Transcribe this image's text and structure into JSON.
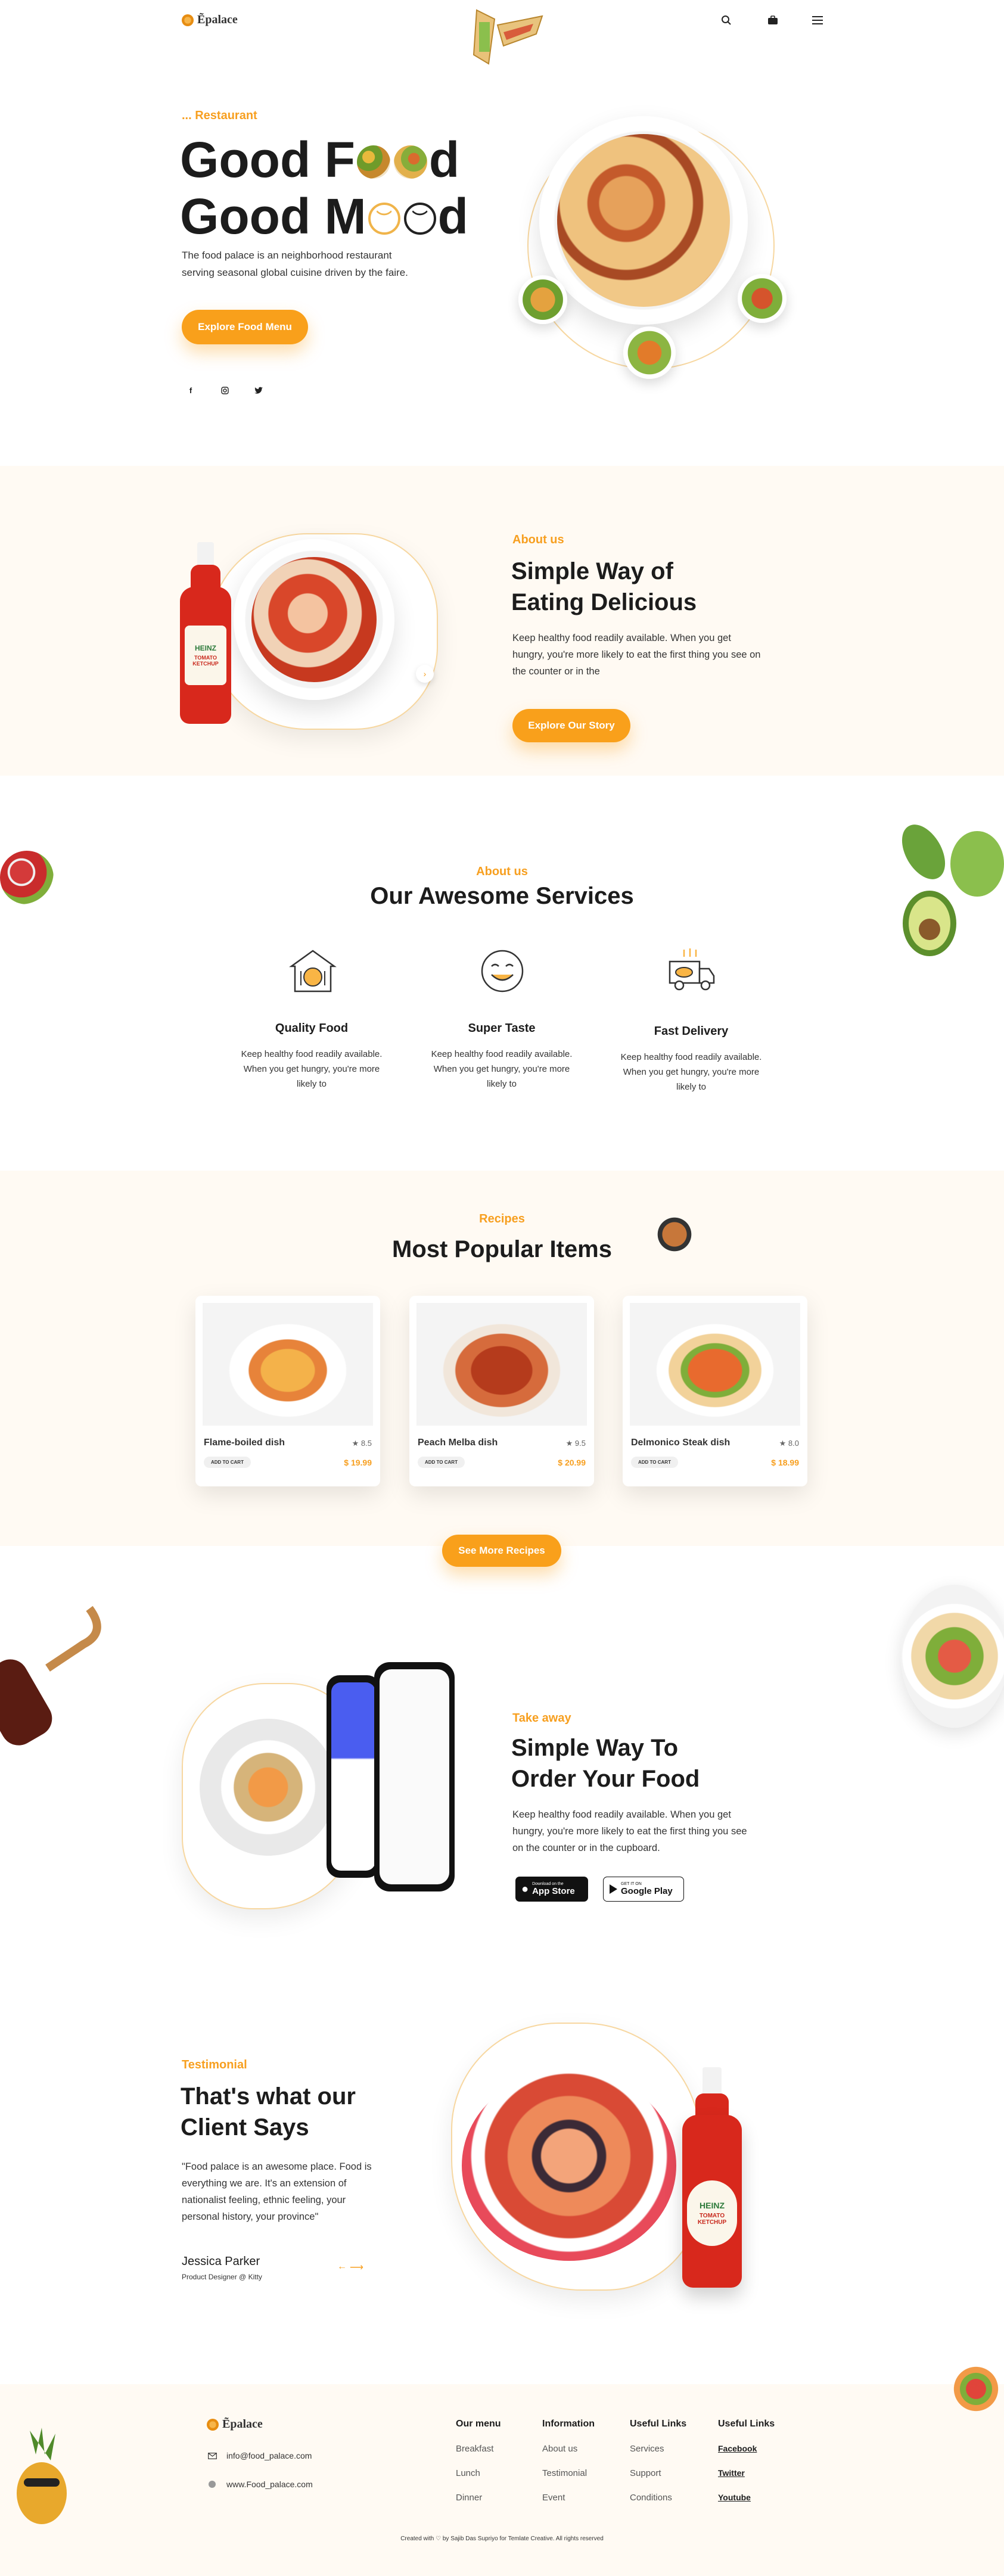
{
  "header": {
    "logo_text": "Ẽpalace",
    "icons": [
      "search-icon",
      "bag-icon",
      "menu-icon"
    ]
  },
  "hero": {
    "tag": "... Restaurant",
    "title_line1_a": "Good F",
    "title_line1_b": "d",
    "title_line2_a": "Good M",
    "title_line2_b": "d",
    "description": "The food palace is an neighborhood restaurant serving seasonal global cuisine driven by the faire.",
    "cta": "Explore Food Menu",
    "social": [
      "facebook-icon",
      "instagram-icon",
      "twitter-icon"
    ]
  },
  "about": {
    "tag": "About us",
    "title_line1": "Simple Way of",
    "title_line2": "Eating Delicious",
    "description": "Keep healthy food readily available. When you get hungry, you're more likely to eat the first thing you see on the counter or in the",
    "cta": "Explore Our Story",
    "bottle_brand": "HEINZ",
    "bottle_label": "TOMATO KETCHUP"
  },
  "services": {
    "tag": "About us",
    "title": "Our Awesome Services",
    "items": [
      {
        "title": "Quality Food",
        "text": "Keep healthy food readily available. When you get hungry, you're more likely to"
      },
      {
        "title": "Super Taste",
        "text": "Keep healthy food readily available. When you get hungry, you're more likely to"
      },
      {
        "title": "Fast Delivery",
        "text": "Keep healthy food readily available. When you get hungry, you're more likely to"
      }
    ]
  },
  "popular": {
    "tag": "Recipes",
    "title": "Most Popular Items",
    "items": [
      {
        "name": "Flame-boiled dish",
        "rating": "★ 8.5",
        "cart": "ADD TO CART",
        "price": "$ 19.99"
      },
      {
        "name": "Peach Melba dish",
        "rating": "★ 9.5",
        "cart": "ADD TO CART",
        "price": "$ 20.99"
      },
      {
        "name": "Delmonico Steak dish",
        "rating": "★ 8.0",
        "cart": "ADD TO CART",
        "price": "$ 18.99"
      }
    ],
    "cta": "See More Recipes"
  },
  "app": {
    "tag": "Take away",
    "title_line1": "Simple Way To",
    "title_line2": "Order Your Food",
    "description": "Keep healthy food readily available. When you get hungry, you're more likely to eat the first thing you see on the counter or in the cupboard.",
    "appstore_small": "Download on the",
    "appstore_big": "App Store",
    "googleplay_small": "GET IT ON",
    "googleplay_big": "Google Play"
  },
  "testimonial": {
    "tag": "Testimonial",
    "title_line1": "That's what our",
    "title_line2": "Client Says",
    "quote": "\"Food palace is an awesome place. Food is everything we are. It's an extension of nationalist feeling, ethnic feeling, your personal history, your province\"",
    "name": "Jessica Parker",
    "role": "Product Designer @ Kitty",
    "bottle_brand": "HEINZ",
    "bottle_label": "TOMATO KETCHUP"
  },
  "footer": {
    "logo_text": "Ẽpalace",
    "email": "info@food_palace.com",
    "website": "www.Food_palace.com",
    "columns": [
      {
        "title": "Our menu",
        "links": [
          "Breakfast",
          "Lunch",
          "Dinner"
        ]
      },
      {
        "title": "Information",
        "links": [
          "About us",
          "Testimonial",
          "Event"
        ]
      },
      {
        "title": "Useful Links",
        "links": [
          "Services",
          "Support",
          "Conditions"
        ]
      },
      {
        "title": "Useful Links",
        "links": [
          "Facebook",
          "Twitter",
          "Youtube"
        ]
      }
    ],
    "credit": "Created with ♡ by Sajib Das Supriyo for Temlate Creative. All rights reserved"
  },
  "colors": {
    "accent": "#f9a01b",
    "cream": "#fffaf3",
    "text": "#1c1c1c"
  }
}
